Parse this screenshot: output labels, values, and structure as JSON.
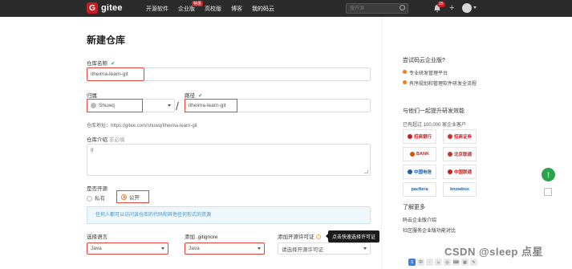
{
  "brand": {
    "logo_letter": "G",
    "name": "gitee"
  },
  "nav": {
    "items": [
      {
        "label": "开源软件"
      },
      {
        "label": "企业版"
      },
      {
        "label": "高校版"
      },
      {
        "label": "博客"
      },
      {
        "label": "我的码云"
      }
    ],
    "beta_badge": "特惠",
    "search_placeholder": "搜开源",
    "notification_count": "25",
    "plus": "+"
  },
  "page": {
    "title": "新建仓库"
  },
  "form": {
    "repo_name_label": "仓库名称",
    "repo_name_value": "itheima-learn-git",
    "owner_label": "归属",
    "owner_value": "Shuwq",
    "slash": "/",
    "path_label": "路径",
    "path_value": "itheima-learn-git",
    "repo_url_text": "仓库地址：https://gitee.com/shuwq/itheima-learn-git",
    "intro_label": "仓库介绍",
    "intro_optional": "非必填",
    "intro_value": "g",
    "opensource_label": "是否开源",
    "private_label": "私有",
    "public_label": "公开",
    "info_text": "任何人都可以访问该仓库的代码和其他任何形式的资源",
    "language_label": "选择语言",
    "language_value": "Java",
    "gitignore_label": "添加 .gitignore",
    "gitignore_value": "Java",
    "license_label": "添加开源许可证",
    "license_placeholder": "请选择开源许可证",
    "tooltip": "点击快速选择许可证"
  },
  "sidebar": {
    "enterprise_title": "尝试码云企业版?",
    "enterprise_items": [
      "专业研发管理平台",
      "有序规划和管理软件研发全流程"
    ],
    "join_title": "与他们一起提升研发效能",
    "join_sub": "已有超过 100,000 家企业客户",
    "client_logos": [
      {
        "name": "招商银行",
        "color": "#c71d23"
      },
      {
        "name": "招商证券",
        "color": "#c0392b"
      },
      {
        "name": "BANK",
        "color": "#d35400"
      },
      {
        "name": "北京联通",
        "color": "#c0392b"
      },
      {
        "name": "中国电信",
        "color": "#1e5fa8"
      },
      {
        "name": "中国联通",
        "color": "#c71d23"
      },
      {
        "name": "pacfiera",
        "color": "#1e5fa8"
      },
      {
        "name": "knowbox",
        "color": "#1e5fa8"
      }
    ],
    "learn_more_title": "了解更多",
    "learn_links": [
      "码云企业版介绍",
      "社区服务企业版功能对比"
    ]
  },
  "floating": {
    "feedback_icon": "!",
    "edit_icon": "edit"
  },
  "watermark": "CSDN @sleep 点星",
  "tray": [
    "S",
    "中",
    "·",
    "☺",
    "◎",
    "⌨",
    "▦",
    "✎"
  ]
}
